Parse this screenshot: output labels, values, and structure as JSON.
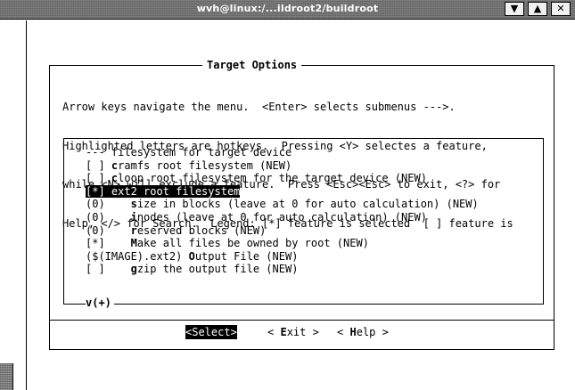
{
  "window": {
    "title": "wvh@linux:/...ildroot2/buildroot",
    "buttons": {
      "shade": "▼",
      "maximize": "▲",
      "close": "✕"
    }
  },
  "dialog": {
    "title": "Target Options",
    "help_lines": [
      "Arrow keys navigate the menu.  <Enter> selects submenus --->.",
      "Highlighted letters are hotkeys.  Pressing <Y> selectes a feature,",
      "while <N> will exclude a feature.  Press <Esc><Esc> to exit, <?> for",
      "Help, </> for Search.  Legend: [*] feature is selected  [ ] feature is"
    ],
    "items": [
      {
        "prefix": "--- ",
        "hotkey": "",
        "text": "filesystem for target device",
        "selected": false
      },
      {
        "prefix": "[ ] ",
        "hotkey": "c",
        "text": "ramfs root filesystem (NEW)",
        "selected": false
      },
      {
        "prefix": "[ ] ",
        "hotkey": "c",
        "text": "loop root filesystem for the target device (NEW)",
        "selected": false
      },
      {
        "prefix": "[*] ",
        "hotkey": "",
        "text": "ext2 root filesystem",
        "selected": true
      },
      {
        "prefix": "(0)    ",
        "hotkey": "s",
        "text": "ize in blocks (leave at 0 for auto calculation) (NEW)",
        "selected": false
      },
      {
        "prefix": "(0)    ",
        "hotkey": "i",
        "text": "nodes (leave at 0 for auto calculation) (NEW)",
        "selected": false
      },
      {
        "prefix": "(0)    ",
        "hotkey": "r",
        "text": "eserved blocks (NEW)",
        "selected": false
      },
      {
        "prefix": "[*]    ",
        "hotkey": "M",
        "text": "ake all files be owned by root (NEW)",
        "selected": false
      },
      {
        "prefix": "($(IMAGE).ext2) ",
        "hotkey": "O",
        "text": "utput File (NEW)",
        "selected": false
      },
      {
        "prefix": "[ ]    ",
        "hotkey": "g",
        "text": "zip the output file (NEW)",
        "selected": false
      }
    ],
    "more_indicator": "v(+)",
    "buttons": {
      "select": "<Select>",
      "exit_pre": "< ",
      "exit_hotkey": "E",
      "exit_rest": "xit >",
      "help_pre": "< ",
      "help_hotkey": "H",
      "help_rest": "elp >"
    }
  }
}
